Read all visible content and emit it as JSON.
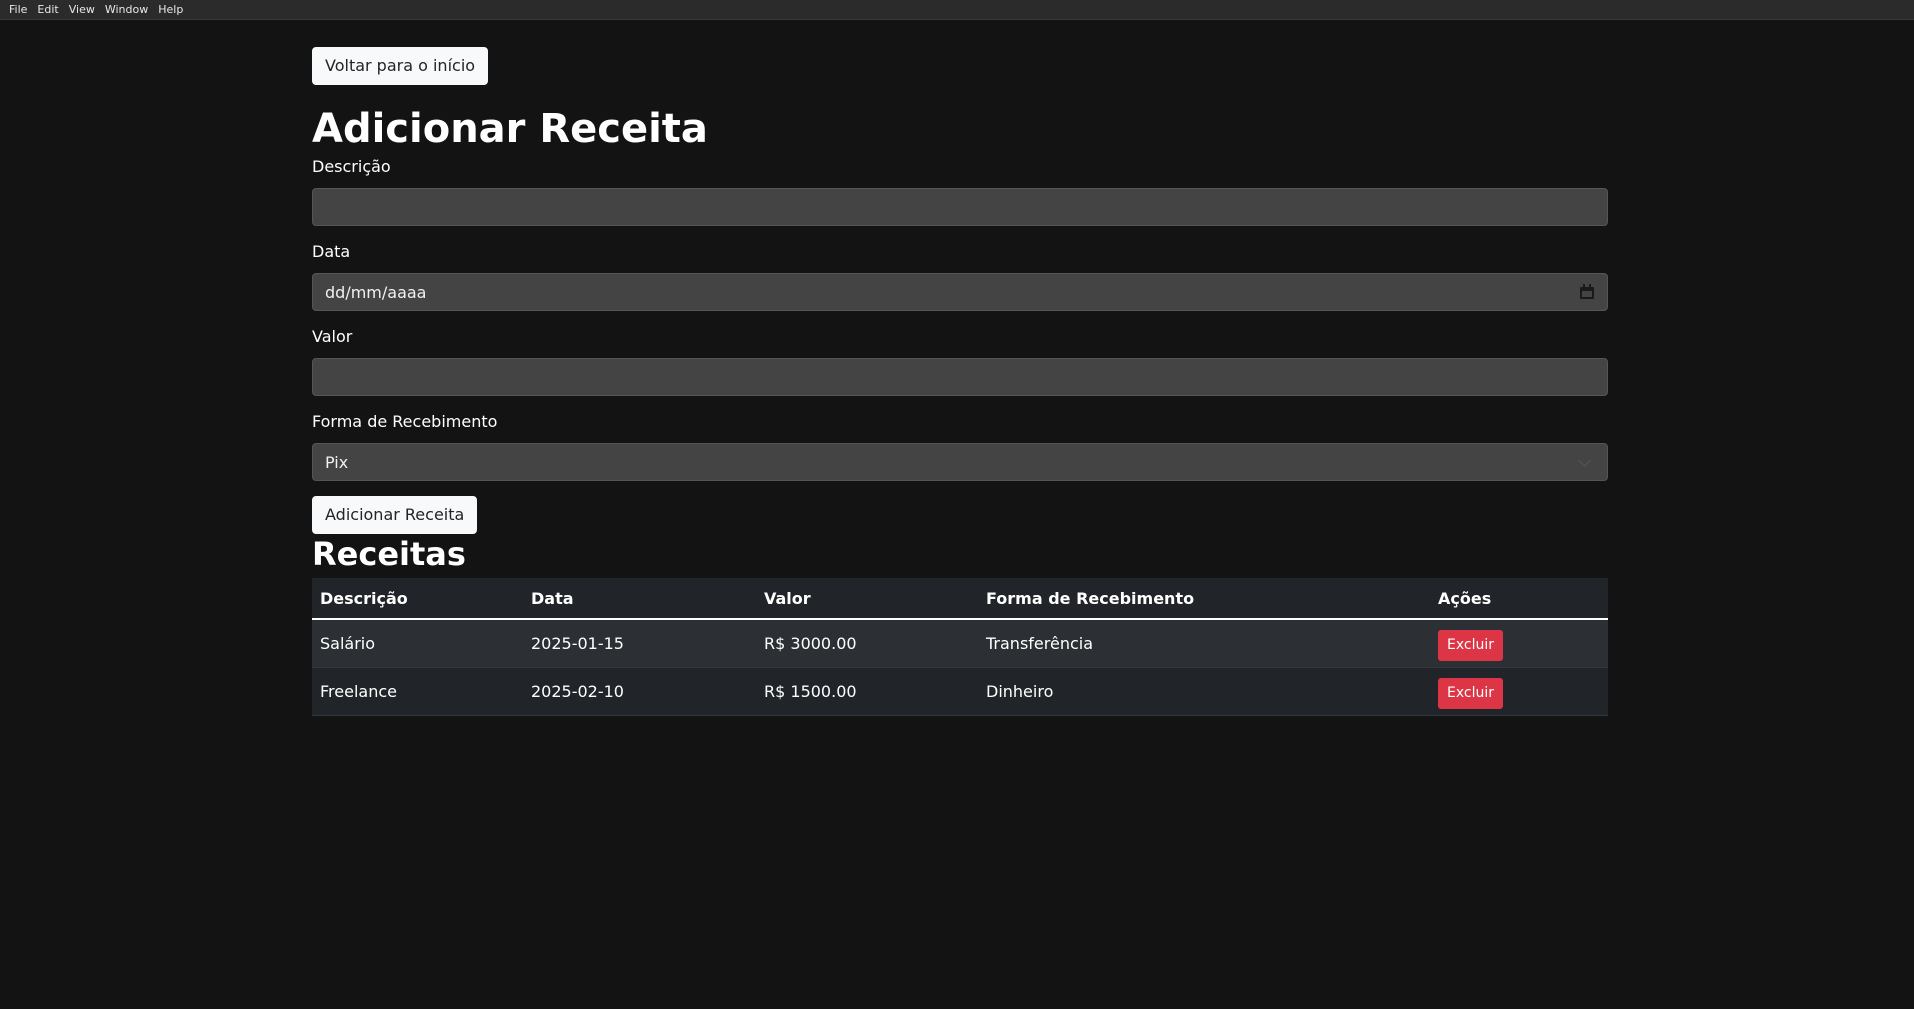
{
  "menubar": {
    "items": [
      "File",
      "Edit",
      "View",
      "Window",
      "Help"
    ]
  },
  "back_button": "Voltar para o início",
  "form": {
    "title": "Adicionar Receita",
    "descricao": {
      "label": "Descrição",
      "value": "",
      "placeholder": ""
    },
    "data": {
      "label": "Data",
      "placeholder": "dd/mm/aaaa"
    },
    "valor": {
      "label": "Valor",
      "value": "",
      "placeholder": ""
    },
    "forma": {
      "label": "Forma de Recebimento",
      "selected": "Pix"
    },
    "submit_label": "Adicionar Receita"
  },
  "receitas": {
    "title": "Receitas",
    "columns": [
      "Descrição",
      "Data",
      "Valor",
      "Forma de Recebimento",
      "Ações"
    ],
    "rows": [
      {
        "descricao": "Salário",
        "data": "2025-01-15",
        "valor": "R$ 3000.00",
        "forma": "Transferência",
        "action": "Excluir"
      },
      {
        "descricao": "Freelance",
        "data": "2025-02-10",
        "valor": "R$ 1500.00",
        "forma": "Dinheiro",
        "action": "Excluir"
      }
    ]
  },
  "colors": {
    "background": "#131313",
    "input_background": "#444444",
    "danger": "#dc3545",
    "table_header": "#212529"
  }
}
